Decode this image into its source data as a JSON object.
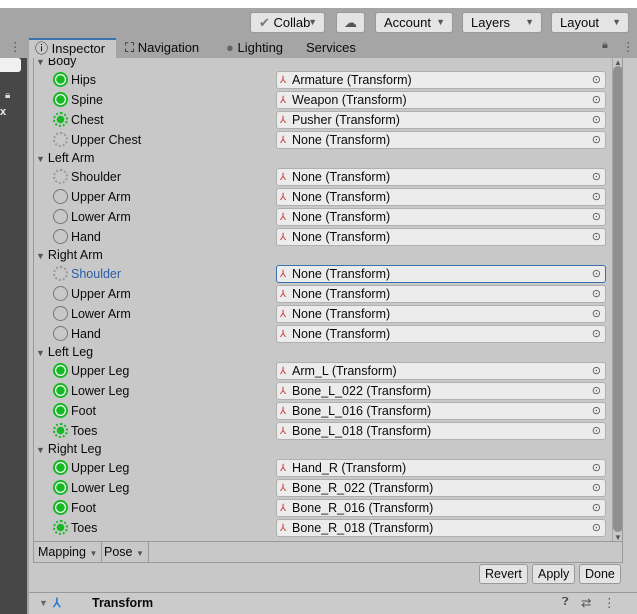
{
  "toolbar": {
    "collab": "Collab",
    "account": "Account",
    "layers": "Layers",
    "layout": "Layout"
  },
  "tabs": [
    "Inspector",
    "Navigation",
    "Lighting",
    "Services"
  ],
  "groups": [
    {
      "label": "Body",
      "bones": [
        {
          "name": "Hips",
          "state": "full",
          "value": "Armature (Transform)"
        },
        {
          "name": "Spine",
          "state": "full",
          "value": "Weapon (Transform)"
        },
        {
          "name": "Chest",
          "state": "dash",
          "value": "Pusher (Transform)"
        },
        {
          "name": "Upper Chest",
          "state": "opt",
          "value": "None (Transform)"
        }
      ]
    },
    {
      "label": "Left Arm",
      "bones": [
        {
          "name": "Shoulder",
          "state": "opt",
          "value": "None (Transform)"
        },
        {
          "name": "Upper Arm",
          "state": "req",
          "value": "None (Transform)"
        },
        {
          "name": "Lower Arm",
          "state": "req",
          "value": "None (Transform)"
        },
        {
          "name": "Hand",
          "state": "req",
          "value": "None (Transform)"
        }
      ]
    },
    {
      "label": "Right Arm",
      "bones": [
        {
          "name": "Shoulder",
          "state": "opt",
          "value": "None (Transform)",
          "selected": true
        },
        {
          "name": "Upper Arm",
          "state": "req",
          "value": "None (Transform)"
        },
        {
          "name": "Lower Arm",
          "state": "req",
          "value": "None (Transform)"
        },
        {
          "name": "Hand",
          "state": "req",
          "value": "None (Transform)"
        }
      ]
    },
    {
      "label": "Left Leg",
      "bones": [
        {
          "name": "Upper Leg",
          "state": "full",
          "value": "Arm_L (Transform)"
        },
        {
          "name": "Lower Leg",
          "state": "full",
          "value": "Bone_L_022 (Transform)"
        },
        {
          "name": "Foot",
          "state": "full",
          "value": "Bone_L_016 (Transform)"
        },
        {
          "name": "Toes",
          "state": "dash",
          "value": "Bone_L_018 (Transform)"
        }
      ]
    },
    {
      "label": "Right Leg",
      "bones": [
        {
          "name": "Upper Leg",
          "state": "full",
          "value": "Hand_R (Transform)"
        },
        {
          "name": "Lower Leg",
          "state": "full",
          "value": "Bone_R_022 (Transform)"
        },
        {
          "name": "Foot",
          "state": "full",
          "value": "Bone_R_016 (Transform)"
        },
        {
          "name": "Toes",
          "state": "dash",
          "value": "Bone_R_018 (Transform)"
        }
      ]
    }
  ],
  "footer": {
    "mapping": "Mapping",
    "pose": "Pose"
  },
  "buttons": {
    "revert": "Revert",
    "apply": "Apply",
    "done": "Done"
  },
  "component": {
    "title": "Transform"
  }
}
